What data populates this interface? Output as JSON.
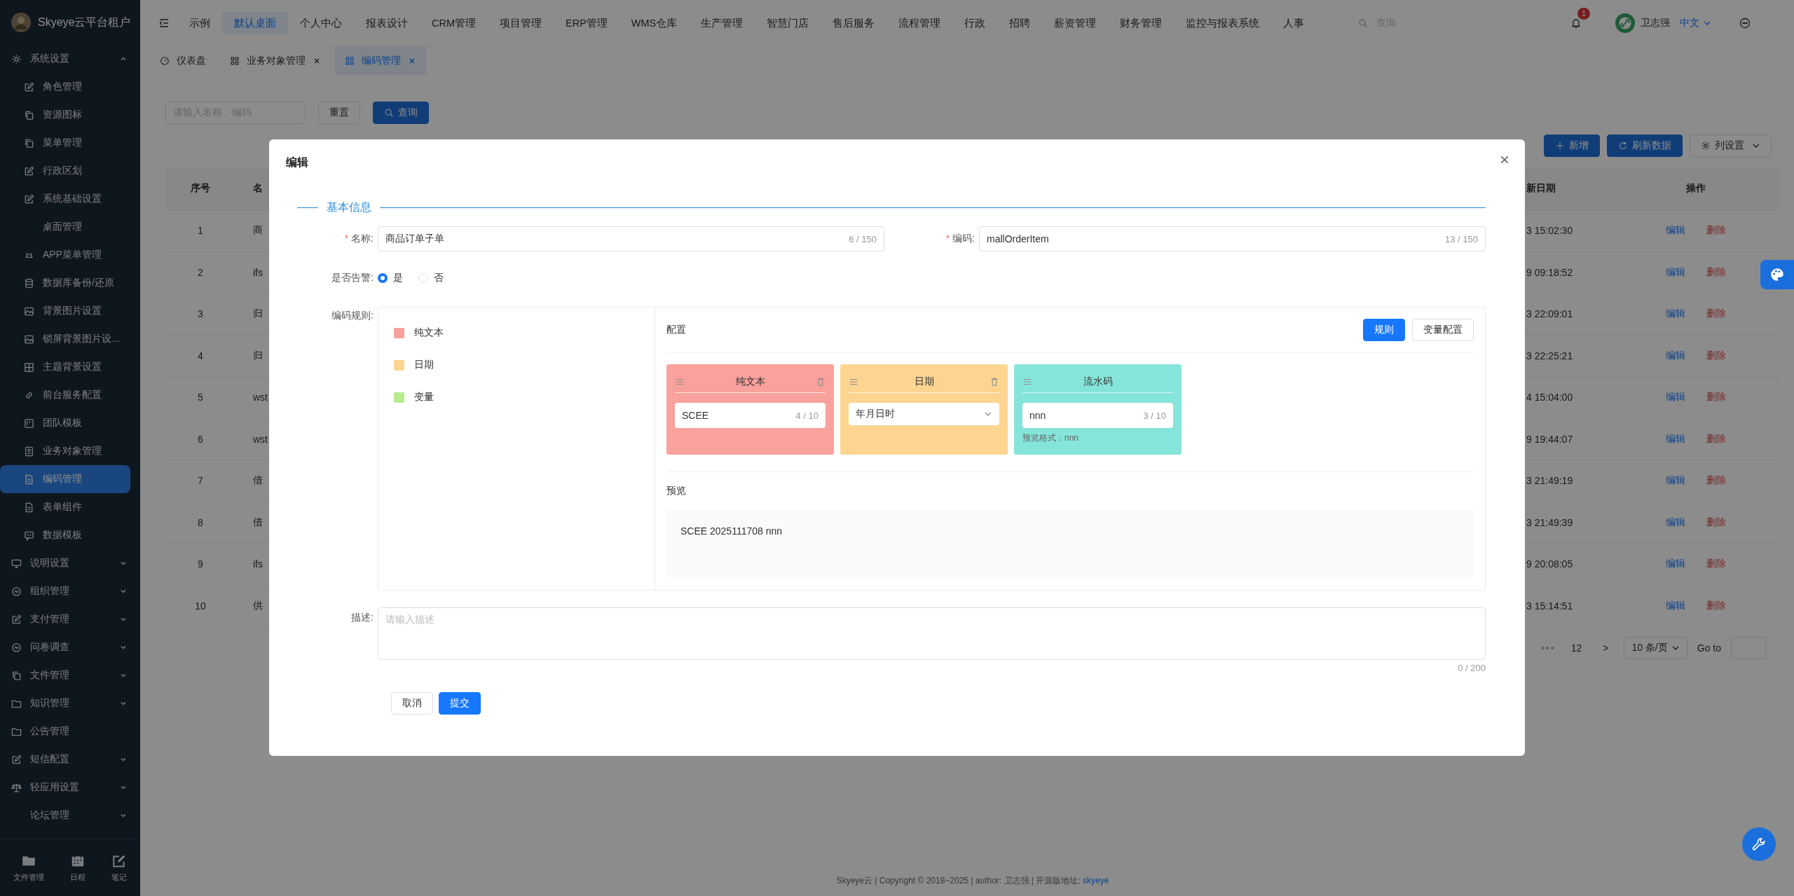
{
  "sidebar": {
    "title": "Skyeye云平台租户",
    "items": [
      {
        "label": "系统设置",
        "expanded": true,
        "children": [
          {
            "label": "角色管理",
            "selected": false
          },
          {
            "label": "资源图标",
            "selected": false
          },
          {
            "label": "菜单管理",
            "selected": false
          },
          {
            "label": "行政区划",
            "selected": false
          },
          {
            "label": "系统基础设置",
            "selected": false
          },
          {
            "label": "桌面管理",
            "selected": false
          },
          {
            "label": "APP菜单管理",
            "selected": false
          },
          {
            "label": "数据库备份/还原",
            "selected": false
          },
          {
            "label": "背景图片设置",
            "selected": false
          },
          {
            "label": "锁屏背景图片设...",
            "selected": false
          },
          {
            "label": "主题背景设置",
            "selected": false
          },
          {
            "label": "前台服务配置",
            "selected": false
          },
          {
            "label": "团队模板",
            "selected": false
          },
          {
            "label": "业务对象管理",
            "selected": false
          },
          {
            "label": "编码管理",
            "selected": true
          },
          {
            "label": "表单组件",
            "selected": false
          },
          {
            "label": "数据模板",
            "selected": false
          }
        ]
      },
      {
        "label": "说明设置",
        "expanded": false
      },
      {
        "label": "组织管理",
        "expanded": false
      },
      {
        "label": "支付管理",
        "expanded": false
      },
      {
        "label": "问卷调查",
        "expanded": false
      },
      {
        "label": "文件管理",
        "expanded": false
      },
      {
        "label": "知识管理",
        "expanded": false
      },
      {
        "label": "公告管理"
      },
      {
        "label": "短信配置",
        "expanded": false
      },
      {
        "label": "轻应用设置",
        "expanded": false
      },
      {
        "label": "论坛管理",
        "expanded": false
      }
    ],
    "bottom": [
      {
        "label": "文件管理"
      },
      {
        "label": "日程"
      },
      {
        "label": "笔记"
      }
    ]
  },
  "topnav": {
    "menu": [
      {
        "label": "示例",
        "selected": false
      },
      {
        "label": "默认桌面",
        "selected": true
      },
      {
        "label": "个人中心",
        "selected": false
      },
      {
        "label": "报表设计",
        "selected": false
      },
      {
        "label": "CRM管理",
        "selected": false
      },
      {
        "label": "项目管理",
        "selected": false
      },
      {
        "label": "ERP管理",
        "selected": false
      },
      {
        "label": "WMS仓库",
        "selected": false
      },
      {
        "label": "生产管理",
        "selected": false
      },
      {
        "label": "智慧门店",
        "selected": false
      },
      {
        "label": "售后服务",
        "selected": false
      },
      {
        "label": "流程管理",
        "selected": false
      },
      {
        "label": "行政",
        "selected": false
      },
      {
        "label": "招聘",
        "selected": false
      },
      {
        "label": "薪资管理",
        "selected": false
      },
      {
        "label": "财务管理",
        "selected": false
      },
      {
        "label": "监控与报表系统",
        "selected": false
      },
      {
        "label": "人事",
        "selected": false
      }
    ],
    "search": {
      "placeholder": "查询"
    },
    "badge": "1",
    "user": "卫志强",
    "language": "中文"
  },
  "tabs": [
    {
      "label": "仪表盘",
      "selected": false,
      "closable": false
    },
    {
      "label": "业务对象管理",
      "selected": false,
      "closable": true
    },
    {
      "label": "编码管理",
      "selected": true,
      "closable": true
    }
  ],
  "toolbar": {
    "search": {
      "placeholder": "请输入名称、编码"
    },
    "reset": "重置",
    "query": "查询",
    "actions": [
      {
        "kind": "add",
        "label": "新增"
      },
      {
        "kind": "refresh",
        "label": "刷新数据"
      },
      {
        "kind": "columns",
        "label": "列设置"
      }
    ]
  },
  "table": {
    "columns": [
      "序号",
      "名",
      "新日期",
      "操作"
    ],
    "rows": [
      {
        "index": "1",
        "name": "商",
        "date": "3 15:02:30",
        "edit": "编辑",
        "delete": "删除"
      },
      {
        "index": "2",
        "name": "ifs",
        "date": "9 09:18:52",
        "edit": "编辑",
        "delete": "删除"
      },
      {
        "index": "3",
        "name": "归",
        "date": "3 22:09:01",
        "edit": "编辑",
        "delete": "删除"
      },
      {
        "index": "4",
        "name": "归",
        "date": "3 22:25:21",
        "edit": "编辑",
        "delete": "删除"
      },
      {
        "index": "5",
        "name": "wst",
        "date": "4 15:04:00",
        "edit": "编辑",
        "delete": "删除"
      },
      {
        "index": "6",
        "name": "wst",
        "date": "9 19:44:07",
        "edit": "编辑",
        "delete": "删除"
      },
      {
        "index": "7",
        "name": "借",
        "date": "3 21:49:19",
        "edit": "编辑",
        "delete": "删除"
      },
      {
        "index": "8",
        "name": "借",
        "date": "3 21:49:39",
        "edit": "编辑",
        "delete": "删除"
      },
      {
        "index": "9",
        "name": "ifs",
        "date": "9 20:08:05",
        "edit": "编辑",
        "delete": "删除"
      },
      {
        "index": "10",
        "name": "供",
        "date": "3 15:14:51",
        "edit": "编辑",
        "delete": "删除"
      }
    ]
  },
  "pagination": {
    "ellipsis": "•••",
    "page": "12",
    "next": ">",
    "page_size": "10 条/页",
    "goto": "Go to"
  },
  "footer": {
    "text": "Skyeye云 | Copyright © 2018~2025 | author: 卫志强 | 开源版地址: ",
    "link": "skyeye"
  },
  "modal": {
    "title": "编辑",
    "section": "基本信息",
    "fields": [
      {
        "label": "名称:",
        "required_mark": "*",
        "value": "商品订单子单",
        "counter": "6 / 150"
      },
      {
        "label": "编码:",
        "required_mark": "*",
        "value": "mallOrderItem",
        "counter": "13 / 150"
      }
    ],
    "alarm": {
      "label": "是否告警:",
      "options": [
        {
          "label": "是",
          "selected": true
        },
        {
          "label": "否",
          "selected": false
        }
      ]
    },
    "rules": {
      "label": "编码规则:",
      "palette": [
        {
          "label": "纯文本",
          "color": "#f9a19c"
        },
        {
          "label": "日期",
          "color": "#fdd591"
        },
        {
          "label": "变量",
          "color": "#b7eb8f"
        }
      ],
      "config_title": "配置",
      "buttons": [
        {
          "kind": "primary",
          "label": "规则"
        },
        {
          "kind": "default",
          "label": "变量配置"
        }
      ],
      "segments": [
        {
          "kind": "text",
          "title": "纯文本",
          "color": "#f9a19c",
          "value": "SCEE",
          "counter": "4 / 10",
          "deletable": true
        },
        {
          "kind": "select",
          "title": "日期",
          "color": "#fdd591",
          "value": "年月日时",
          "deletable": true
        },
        {
          "kind": "serial",
          "title": "流水码",
          "color": "#86e5da",
          "value": "nnn",
          "counter": "3 / 10",
          "hint": "预览格式：nnn",
          "deletable": false
        }
      ],
      "preview_title": "预览",
      "preview": "SCEE 2025111708 nnn"
    },
    "description": {
      "label": "描述:",
      "placeholder": "请输入描述",
      "counter": "0 / 200"
    },
    "cancel": "取消",
    "submit": "提交"
  }
}
